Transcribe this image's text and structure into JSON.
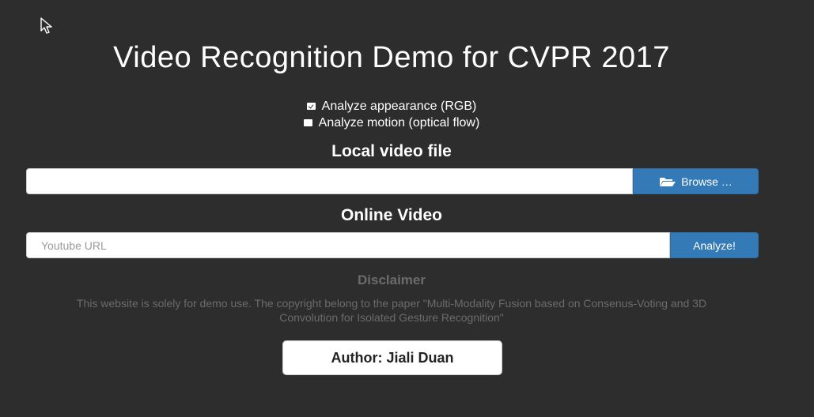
{
  "title": "Video Recognition Demo for CVPR 2017",
  "options": [
    {
      "label": "Analyze appearance (RGB)",
      "checked": true
    },
    {
      "label": "Analyze motion (optical flow)",
      "checked": false
    }
  ],
  "local": {
    "heading": "Local video file",
    "file_value": "",
    "browse_label": "Browse …",
    "browse_icon": "folder-open-icon"
  },
  "online": {
    "heading": "Online Video",
    "url_value": "",
    "placeholder": "Youtube URL",
    "analyze_label": "Analyze!"
  },
  "disclaimer": {
    "title": "Disclaimer",
    "text": "This website is solely for demo use. The copyright belong to the paper \"Multi-Modality Fusion based on Consenus-Voting and 3D Convolution for Isolated Gesture Recognition\""
  },
  "author_label": "Author: Jiali Duan",
  "colors": {
    "background": "#2d2d2d",
    "primary": "#337ab7",
    "muted_text": "#6b6b6b"
  }
}
